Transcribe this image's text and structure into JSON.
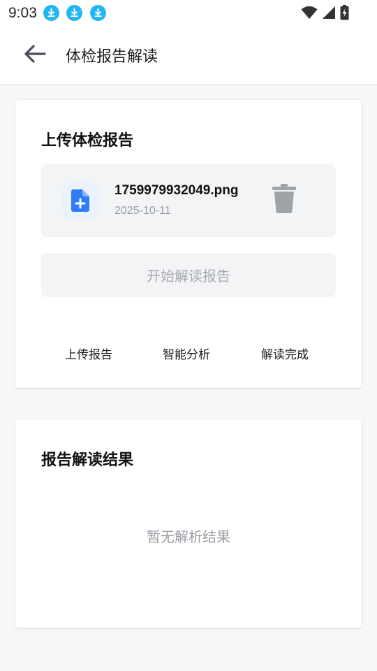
{
  "status_bar": {
    "time": "9:03",
    "notification_icons": [
      "download-icon",
      "download-icon",
      "download-icon"
    ],
    "system_icons": [
      "wifi-icon",
      "signal-icon",
      "battery-charging-icon"
    ]
  },
  "header": {
    "back_icon": "arrow-left-icon",
    "title": "体检报告解读"
  },
  "upload_card": {
    "title": "上传体检报告",
    "file": {
      "icon": "file-add-icon",
      "name": "1759979932049.png",
      "date": "2025-10-11",
      "delete_icon": "trash-icon"
    },
    "start_button_label": "开始解读报告",
    "steps": [
      "上传报告",
      "智能分析",
      "解读完成"
    ]
  },
  "result_card": {
    "title": "报告解读结果",
    "empty_text": "暂无解析结果"
  },
  "colors": {
    "accent": "#2e7cf6",
    "download_badge": "#21b7f2",
    "muted_text": "#9a9ea5",
    "disabled_button_bg": "#f3f4f6",
    "trash_gray": "#9ea2a9"
  }
}
